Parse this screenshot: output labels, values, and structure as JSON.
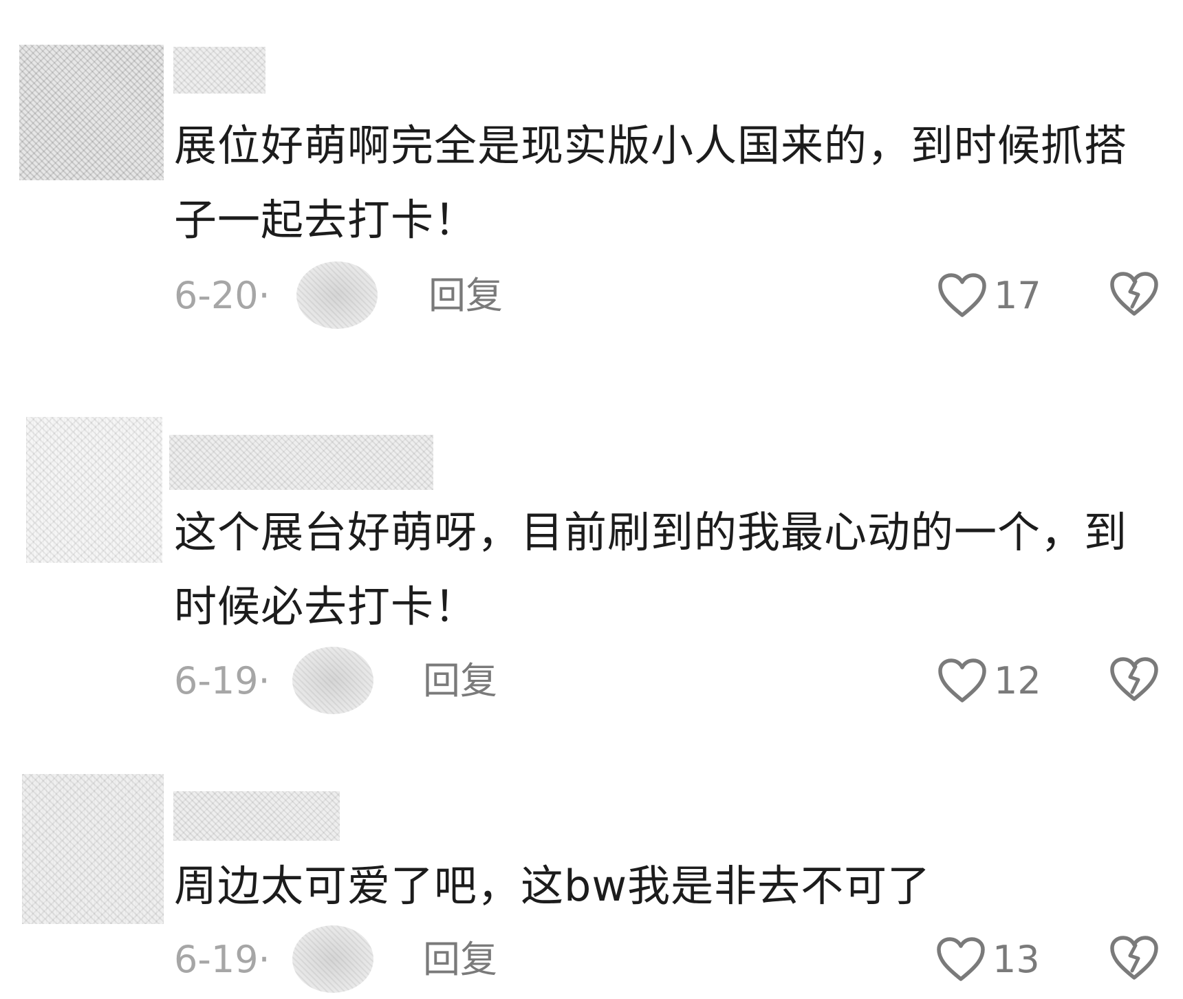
{
  "comments": [
    {
      "text": "展位好萌啊完全是现实版小人国来的，到时候抓搭子一起去打卡！",
      "date": "6-20·",
      "reply_label": "回复",
      "like_count": "17",
      "like_icon": "heart-outline-icon",
      "dislike_icon": "broken-heart-icon"
    },
    {
      "text": "这个展台好萌呀，目前刷到的我最心动的一个，到时候必去打卡！",
      "date": "6-19·",
      "reply_label": "回复",
      "like_count": "12",
      "like_icon": "heart-outline-icon",
      "dislike_icon": "broken-heart-icon"
    },
    {
      "text": "周边太可爱了吧，这bw我是非去不可了",
      "date": "6-19·",
      "reply_label": "回复",
      "like_count": "13",
      "like_icon": "heart-outline-icon",
      "dislike_icon": "broken-heart-icon"
    }
  ],
  "colors": {
    "text": "#1c1c1c",
    "meta": "#a6a6a6",
    "action": "#7a7a7a"
  }
}
